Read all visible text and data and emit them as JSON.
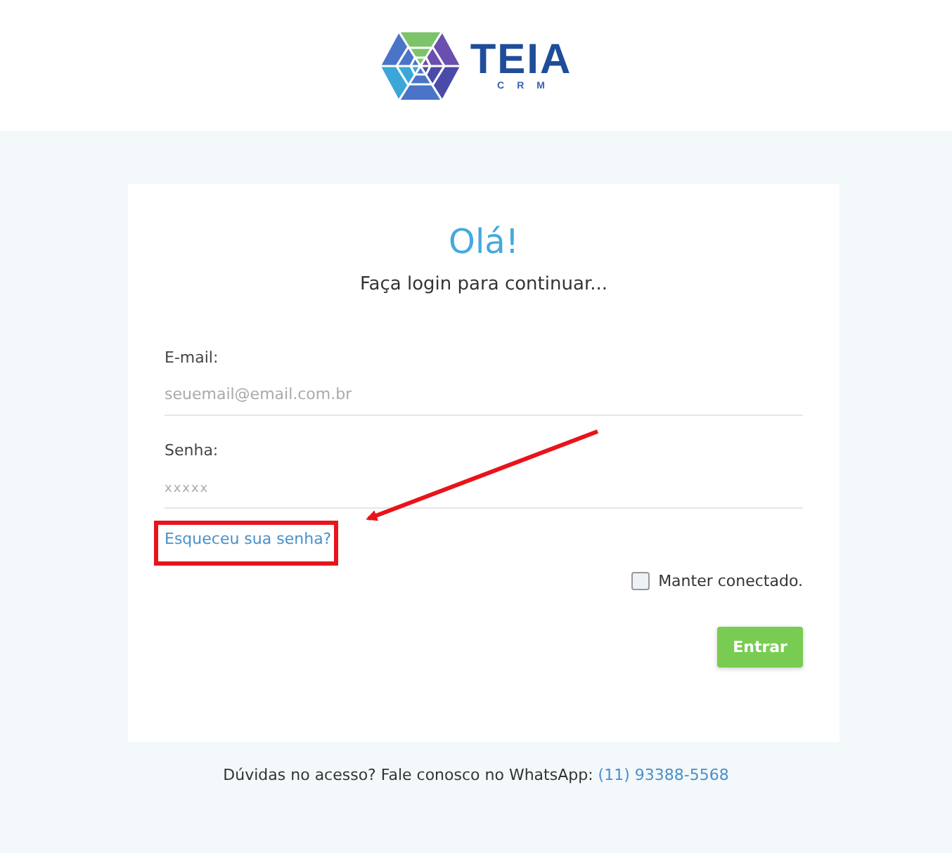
{
  "logo": {
    "name": "TEIA",
    "tagline": "CRM"
  },
  "card": {
    "title": "Olá!",
    "subtitle": "Faça login para continuar...",
    "fields": [
      {
        "label": "E-mail:",
        "placeholder": "seuemail@email.com.br",
        "kind": "email"
      },
      {
        "label": "Senha:",
        "placeholder": "xxxxx",
        "kind": "password"
      }
    ],
    "forgot_link": "Esqueceu sua senha?",
    "remember": {
      "label": "Manter conectado.",
      "checked": false
    },
    "submit": "Entrar"
  },
  "footer": {
    "text": "Dúvidas no acesso? Fale conosco no WhatsApp:",
    "phone": "(11) 93388-5568"
  }
}
